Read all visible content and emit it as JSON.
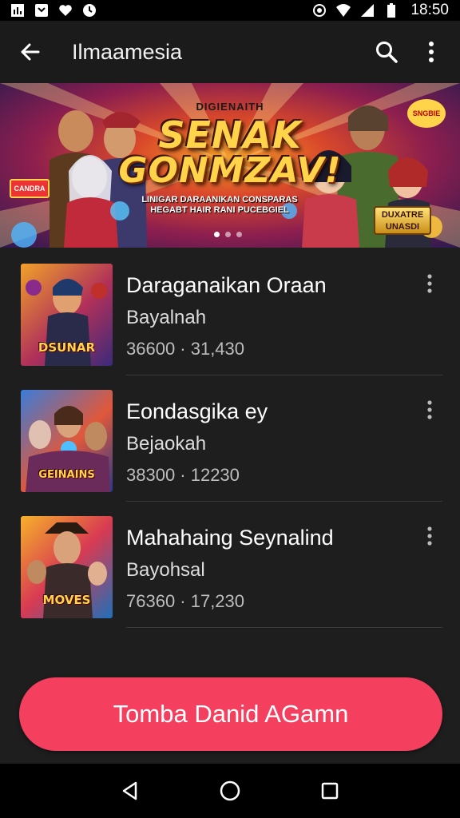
{
  "status_bar": {
    "time": "18:50",
    "left_icons": [
      "gallery-icon",
      "messenger-icon",
      "heart-icon",
      "clock-icon"
    ],
    "right_icons": [
      "silent-icon",
      "wifi-icon",
      "signal-icon",
      "battery-icon"
    ]
  },
  "app_bar": {
    "title": "Ilmaamesia",
    "icons": [
      "back-arrow-icon",
      "search-icon",
      "more-vertical-icon"
    ]
  },
  "banner": {
    "kicker": "DIGIENAITH",
    "title_line1": "SENAK",
    "title_line2": "GONMZAV!",
    "subtitle": "LINIGAR DARAANIKAN CONSPARAS HEGABT HAIR RANI PUCEBGIEL",
    "badge_left": "CANDRA",
    "badge_right": "SNGBIE",
    "corner_button": "DUXATRE UNASDI",
    "pager": {
      "count": 3,
      "active": 0
    }
  },
  "list": {
    "items": [
      {
        "title": "Daraganaikan Oraan",
        "subtitle": "Bayalnah",
        "meta": "36600 · 31,430",
        "thumb_label": "DSUNAR",
        "thumb_colors": [
          "#f0a12a",
          "#b0305a",
          "#3b2a7a"
        ]
      },
      {
        "title": "Eondasgika ey",
        "subtitle": "Bejaokah",
        "meta": "38300 · 12230",
        "thumb_label": "GEINAINS",
        "thumb_colors": [
          "#3a7cd8",
          "#e0583a",
          "#2a3a8a"
        ]
      },
      {
        "title": "Mahahaing Seynalind",
        "subtitle": "Bayohsal",
        "meta": "76360 · 17,230",
        "thumb_label": "MOVES",
        "thumb_colors": [
          "#f6b12a",
          "#d83a52",
          "#1f6fb8"
        ]
      }
    ]
  },
  "primary_button": {
    "label": "Tomba Danid AGamn",
    "color": "#f43f5e"
  },
  "nav_bar": {
    "icons": [
      "back-triangle-icon",
      "home-circle-icon",
      "recents-square-icon"
    ]
  }
}
